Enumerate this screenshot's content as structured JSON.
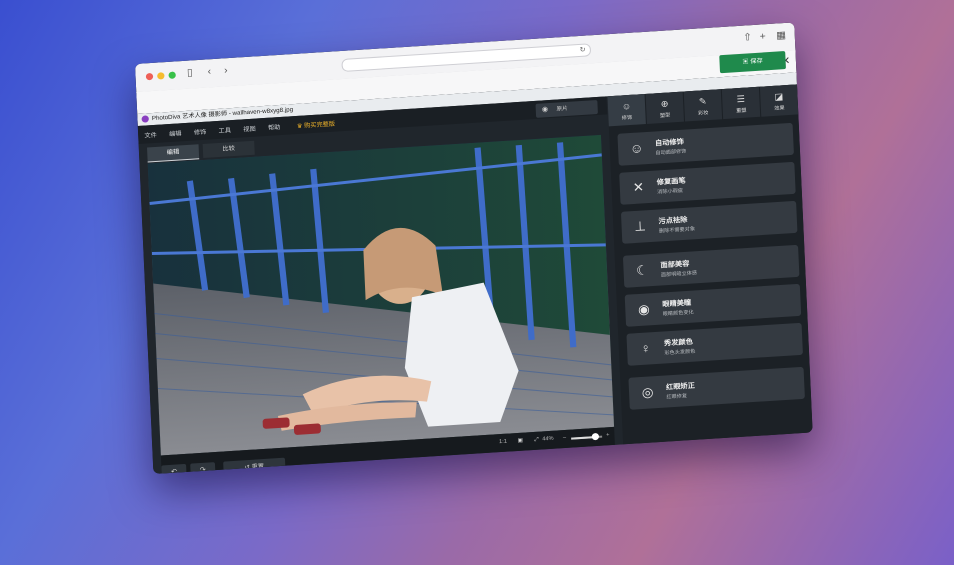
{
  "app": {
    "title": "PhotoDiva 艺术人像 摄影师 - wallhaven-w8xyg8.jpg",
    "save_label": "保存",
    "menu": [
      "文件",
      "编辑",
      "修饰",
      "工具",
      "视图",
      "帮助"
    ],
    "upgrade_label": "购买完整版",
    "original_toggle_label": "原片",
    "view_tabs": [
      "编辑",
      "比较"
    ],
    "active_view_tab": 0
  },
  "right_panel": {
    "tabs": [
      {
        "label": "修饰",
        "icon": "portrait-icon"
      },
      {
        "label": "塑型",
        "icon": "crosshair-icon"
      },
      {
        "label": "彩妆",
        "icon": "brush-icon"
      },
      {
        "label": "重塑",
        "icon": "sliders-icon"
      },
      {
        "label": "效果",
        "icon": "effects-icon"
      }
    ],
    "active_tab": 0,
    "tools": [
      {
        "title": "自动修饰",
        "subtitle": "自动面部修饰",
        "icon": "face-scan-icon",
        "glyph": "☺"
      },
      {
        "title": "修复画笔",
        "subtitle": "消除小瑕疵",
        "icon": "bandage-icon",
        "glyph": "✕"
      },
      {
        "title": "污点祛除",
        "subtitle": "删除不需要对象",
        "icon": "stamp-icon",
        "glyph": "⊥"
      },
      {
        "title": "面部美容",
        "subtitle": "面部明暗立体感",
        "icon": "face-profile-icon",
        "glyph": "☾"
      },
      {
        "title": "眼睛美瞳",
        "subtitle": "眼睛颜色变化",
        "icon": "eye-icon",
        "glyph": "◉"
      },
      {
        "title": "秀发颜色",
        "subtitle": "彩色头发颜色",
        "icon": "hair-icon",
        "glyph": "♀"
      },
      {
        "title": "红眼矫正",
        "subtitle": "红眼修复",
        "icon": "red-eye-icon",
        "glyph": "◎"
      }
    ]
  },
  "canvas": {
    "zoom_fit_label": "1:1",
    "zoom_percent_label": "44%",
    "zoom_level": 0.75,
    "reset_label": "重置"
  },
  "colors": {
    "save_green": "#1f8a4c",
    "upgrade_gold": "#f0b42a",
    "panel_dark": "#1c2126"
  }
}
